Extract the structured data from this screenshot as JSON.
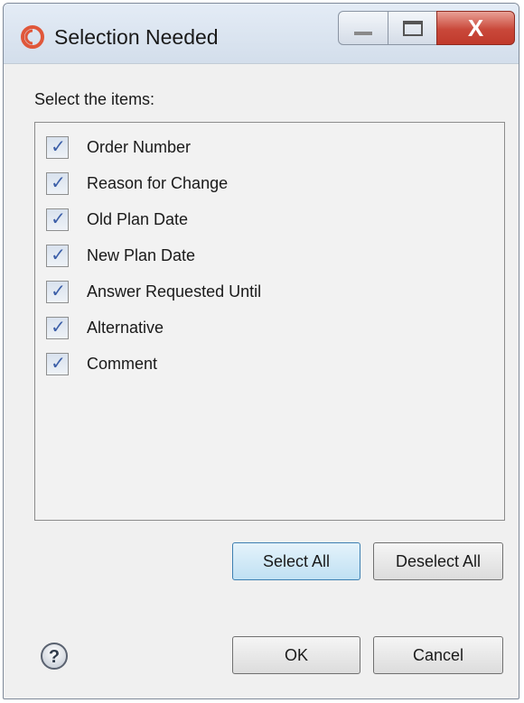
{
  "window": {
    "title": "Selection Needed",
    "close_glyph": "X"
  },
  "dialog": {
    "prompt": "Select the items:",
    "items": [
      {
        "label": "Order Number",
        "checked": true
      },
      {
        "label": "Reason for Change",
        "checked": true
      },
      {
        "label": "Old Plan Date",
        "checked": true
      },
      {
        "label": "New Plan Date",
        "checked": true
      },
      {
        "label": "Answer Requested Until",
        "checked": true
      },
      {
        "label": "Alternative",
        "checked": true
      },
      {
        "label": "Comment",
        "checked": true
      }
    ],
    "check_glyph": "✓"
  },
  "buttons": {
    "select_all": "Select All",
    "deselect_all": "Deselect All",
    "ok": "OK",
    "cancel": "Cancel"
  },
  "icons": {
    "app": "app-logo-icon",
    "help": "help-icon"
  },
  "colors": {
    "accent": "#3c5fa8",
    "close_button": "#c9483a",
    "focus_border": "#3c7fb1"
  }
}
